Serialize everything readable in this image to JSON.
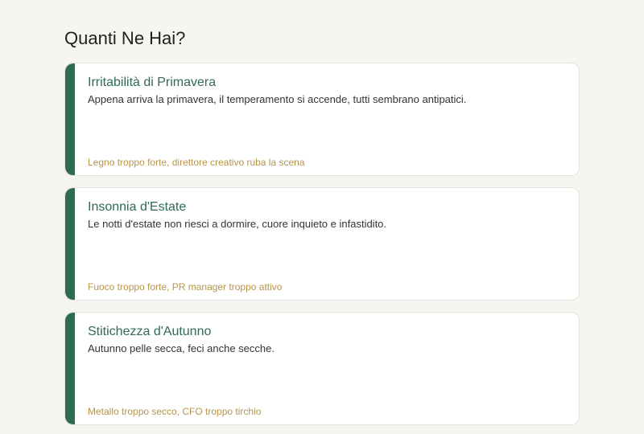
{
  "page": {
    "title": "Quanti Ne Hai?"
  },
  "cards": [
    {
      "title": "Irritabilità di Primavera",
      "description": "Appena arriva la primavera, il temperamento si accende, tutti sembrano antipatici.",
      "note": "Legno troppo forte, direttore creativo ruba la scena"
    },
    {
      "title": "Insonnia d'Estate",
      "description": "Le notti d'estate non riesci a dormire, cuore inquieto e infastidito.",
      "note": "Fuoco troppo forte, PR manager troppo attivo"
    },
    {
      "title": "Stitichezza d'Autunno",
      "description": "Autunno pelle secca, feci anche secche.",
      "note": "Metallo troppo secco, CFO troppo tirchio"
    }
  ],
  "colors": {
    "background": "#f7f5f0",
    "accent": "#2e6b52",
    "note": "#b8944a",
    "card": "#ffffff"
  }
}
